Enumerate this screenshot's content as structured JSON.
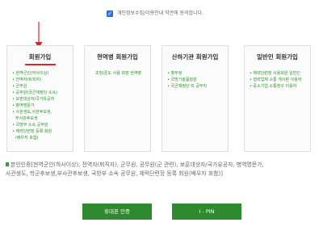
{
  "consent": {
    "checked": true,
    "label": "개인정보수집/이용안내 약관에 동의합니다."
  },
  "cards": [
    {
      "title": "회원가입",
      "items": [
        "• 현역군인(하사이상)",
        "• 전역자(퇴직자)",
        "• 군무원",
        "• 공무원(국군재정단 소속)",
        "• 보훈대상자/국가유공자",
        "• 병역명문가",
        "• 사관생도,사관후보생,",
        "  부사관후보생",
        "• 국방부 소속 공무원",
        "• 체력단련장 등록 회원",
        "  (배우자 포함)"
      ]
    },
    {
      "title": "현역병 회원가입",
      "items": [
        "초빙/준도 사용 희망 현역병"
      ]
    },
    {
      "title": "산하기관 회원가입",
      "items": [
        "• 병무청",
        "• 국방기술품질원",
        "• 국군재정단 외 공무직"
      ]
    },
    {
      "title": "일반인 회원가입",
      "items": [
        "• 체력단련장 사용회원 일반인",
        "• 협력업체 소통 게시판 이용자",
        "• 중소기업 소통창구 이용자"
      ]
    }
  ],
  "description": {
    "line1": "본인인증[현역군인(하사이상), 전역자(퇴직자), 군무원, 공무원(군 관련), 보훈대상자/국가유공자, 병역명문가,",
    "line2": "사관생도, 학군후보생,부사관후보생, 국방부 소속 공무원, 체력단련장 등록 회원(배우자 포함)]"
  },
  "buttons": {
    "phone_auth": "휴대폰 인증",
    "ipin": "I - PIN"
  },
  "colors": {
    "accent_green": "#2f8a2f",
    "list_green": "#2f8f2f",
    "arrow_red": "#d22a2a"
  }
}
